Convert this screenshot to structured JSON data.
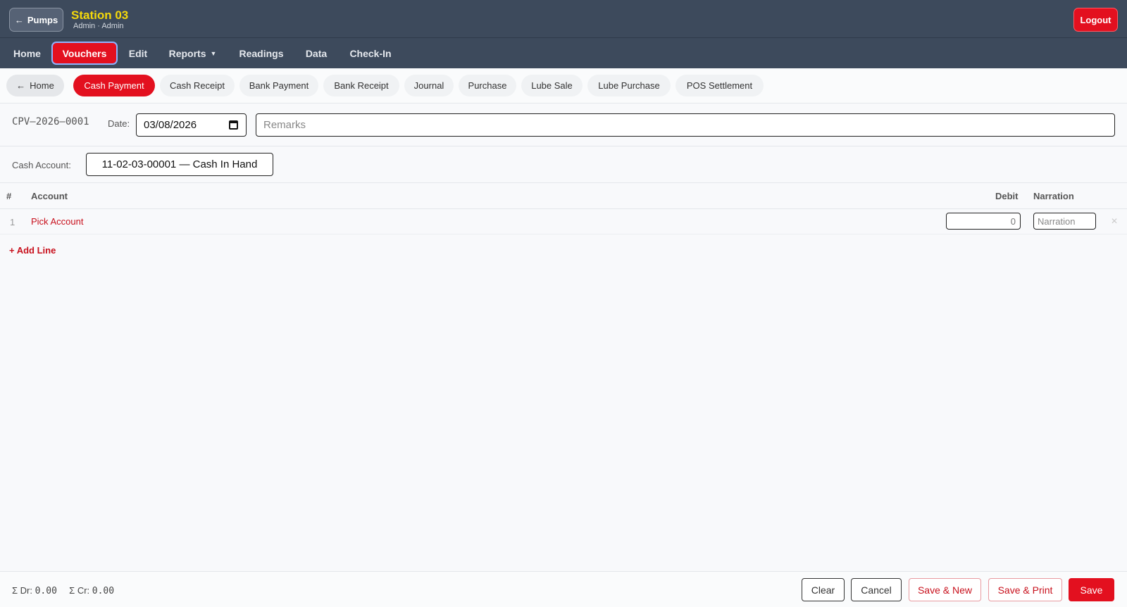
{
  "header": {
    "back_label": "Pumps",
    "station_title": "Station 03",
    "user_role": "Admin · Admin",
    "logout_label": "Logout"
  },
  "nav": {
    "items": [
      {
        "label": "Home"
      },
      {
        "label": "Vouchers",
        "active": true
      },
      {
        "label": "Edit"
      },
      {
        "label": "Reports"
      },
      {
        "label": "Readings"
      },
      {
        "label": "Data"
      },
      {
        "label": "Check-In"
      }
    ]
  },
  "subnav": {
    "home_label": "Home",
    "tabs": [
      {
        "label": "Cash Payment",
        "active": true
      },
      {
        "label": "Cash Receipt"
      },
      {
        "label": "Bank Payment"
      },
      {
        "label": "Bank Receipt"
      },
      {
        "label": "Journal"
      },
      {
        "label": "Purchase"
      },
      {
        "label": "Lube Sale"
      },
      {
        "label": "Lube Purchase"
      },
      {
        "label": "POS Settlement"
      }
    ]
  },
  "voucher": {
    "number": "CPV—2026—0001",
    "date_label": "Date:",
    "date_value": "03/08/2026",
    "remarks_placeholder": "Remarks",
    "cash_account_label": "Cash Account:",
    "cash_account_value": "11-02-03-00001 — Cash In Hand"
  },
  "table": {
    "columns": {
      "num": "#",
      "account": "Account",
      "debit": "Debit",
      "narration": "Narration"
    },
    "rows": [
      {
        "num": "1",
        "account": "Pick Account",
        "debit": "0",
        "narration_placeholder": "Narration"
      }
    ],
    "add_line_label": "+ Add Line"
  },
  "footer": {
    "dr_label": "Σ Dr:",
    "dr_value": "0.00",
    "cr_label": "Σ Cr:",
    "cr_value": "0.00",
    "buttons": {
      "clear": "Clear",
      "cancel": "Cancel",
      "save_new": "Save & New",
      "save_print": "Save & Print",
      "save": "Save"
    }
  },
  "colors": {
    "header_bg": "#3d4a5c",
    "accent": "#e3101f",
    "station_title": "#f5d90a",
    "link_red": "#c8101c"
  },
  "icons": {
    "back": "arrow-left-icon",
    "reports_caret": "chevron-down-icon",
    "date_picker": "calendar-icon",
    "remove_row": "close-icon"
  }
}
